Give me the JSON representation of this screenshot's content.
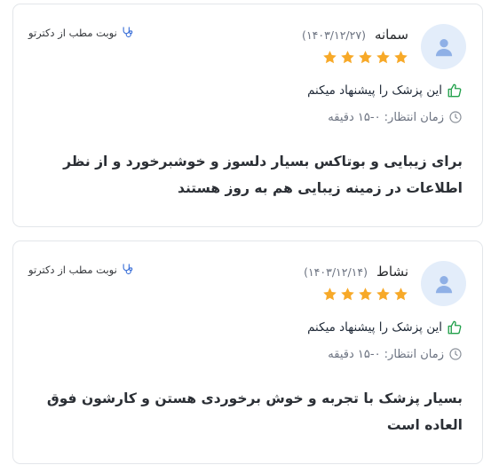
{
  "reviews": [
    {
      "name": "سمانه",
      "date": "(۱۴۰۳/۱۲/۲۷)",
      "rating": 5,
      "appointment_label": "نوبت مطب از دکترتو",
      "recommend_text": "این پزشک را پیشنهاد میکنم",
      "wait_time": "زمان انتظار: ۰-۱۵ دقیقه",
      "comment": "برای زیبایی و بوتاکس بسیار دلسوز و خوشبرخورد و از نظر اطلاعات در زمینه زیبایی هم به روز هستند"
    },
    {
      "name": "نشاط",
      "date": "(۱۴۰۳/۱۲/۱۴)",
      "rating": 5,
      "appointment_label": "نوبت مطب از دکترتو",
      "recommend_text": "این پزشک را پیشنهاد میکنم",
      "wait_time": "زمان انتظار: ۰-۱۵ دقیقه",
      "comment": "بسیار پزشک با تجربه و خوش برخوردی هستن و کارشون فوق العاده است"
    }
  ],
  "colors": {
    "star": "#f7a928",
    "recommend_icon": "#22a04b",
    "appointment_icon": "#3a6fd8",
    "avatar_bg": "#e3edfa",
    "avatar_fg": "#8fb0e6"
  },
  "icons": {
    "avatar": "user-avatar-icon",
    "star": "star-icon",
    "appointment": "stethoscope-icon",
    "recommend": "thumbs-up-icon",
    "wait": "clock-icon"
  }
}
